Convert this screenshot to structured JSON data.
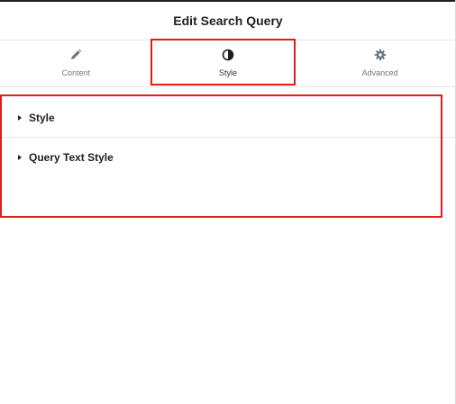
{
  "header": {
    "title": "Edit Search Query"
  },
  "tabs": [
    {
      "label": "Content",
      "icon": "pencil-icon",
      "active": false
    },
    {
      "label": "Style",
      "icon": "contrast-icon",
      "active": true
    },
    {
      "label": "Advanced",
      "icon": "gear-icon",
      "active": false
    }
  ],
  "sections": [
    {
      "title": "Style"
    },
    {
      "title": "Query Text Style"
    }
  ],
  "colors": {
    "highlight": "#e21b1b",
    "icon": "#6d7882",
    "text": "#1f1f1f"
  }
}
